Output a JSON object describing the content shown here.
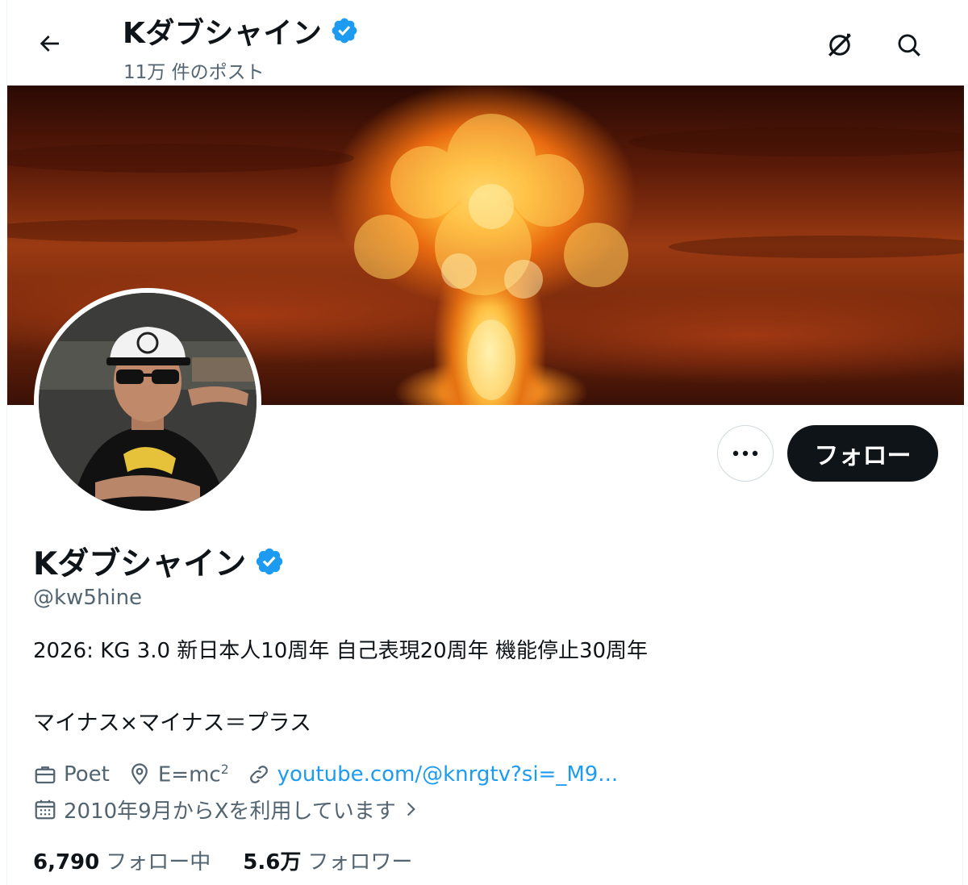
{
  "header": {
    "title": "Kダブシャイン",
    "post_count": "11万 件のポスト"
  },
  "profile": {
    "display_name": "Kダブシャイン",
    "handle": "@kw5hine",
    "bio_line1": "2026: KG 3.0 新日本人10周年 自己表現20周年 機能停止30周年",
    "bio_line2": "マイナス×マイナス＝プラス",
    "profession": "Poet",
    "location_base": "E=mc",
    "location_sup": "2",
    "website": "youtube.com/@knrgtv?si=_M9...",
    "joined": "2010年9月からXを利用しています"
  },
  "actions": {
    "follow_label": "フォロー"
  },
  "stats": {
    "following_count": "6,790",
    "following_label": "フォロー中",
    "followers_count": "5.6万",
    "followers_label": "フォロワー"
  },
  "colors": {
    "accent": "#1d9bf0",
    "verified": "#1d9bf0",
    "text_primary": "#0f1419",
    "text_secondary": "#536471"
  }
}
